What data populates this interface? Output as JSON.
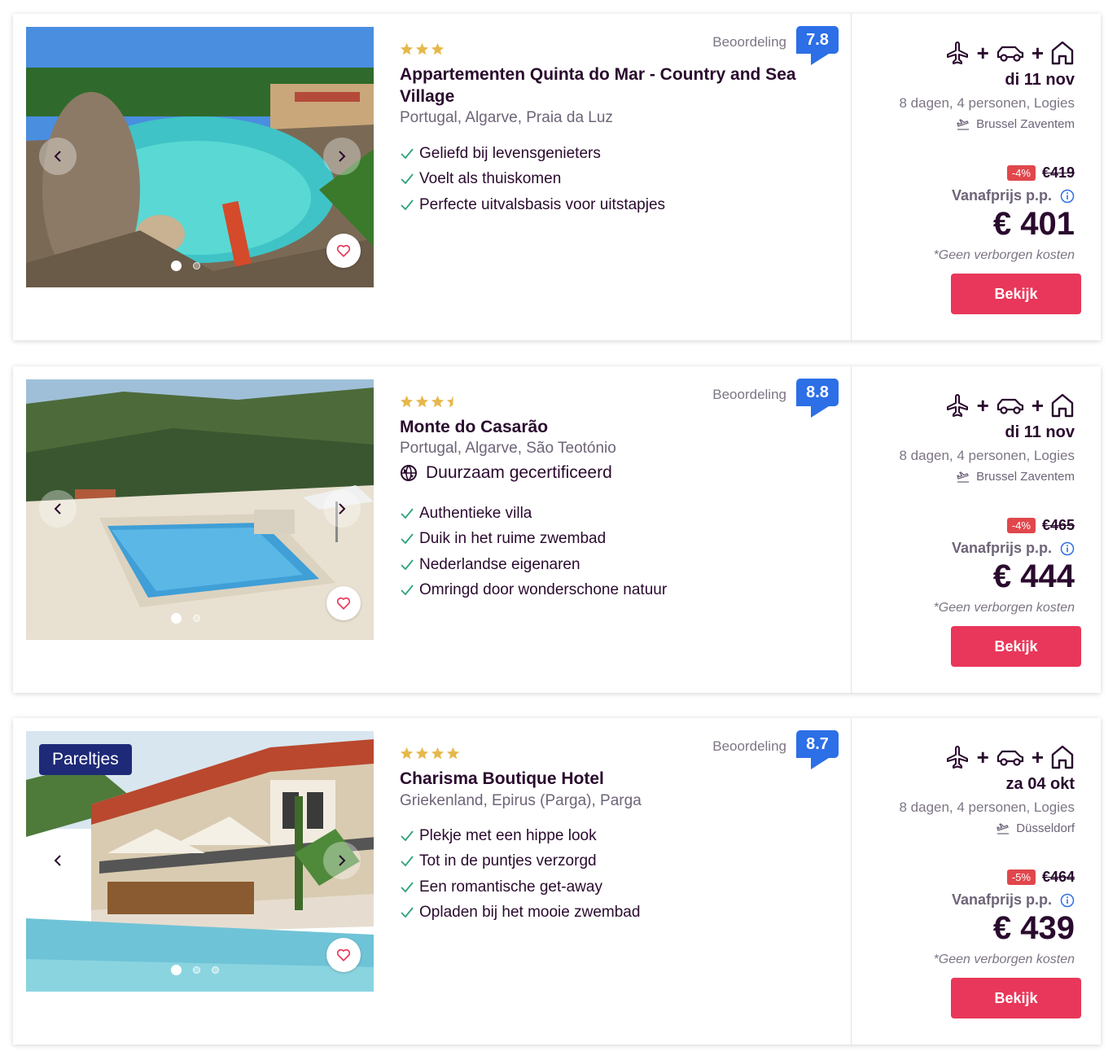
{
  "colors": {
    "accent": "#e8375a",
    "rating": "#2c6fe6",
    "discount": "#e0474c",
    "tag": "#1e2a78",
    "check": "#2fa37a",
    "star": "#e6b84c"
  },
  "labels": {
    "rating": "Beoordeling",
    "from_price": "Vanafprijs p.p.",
    "no_hidden_costs": "*Geen verborgen kosten",
    "cta": "Bekijk"
  },
  "results": [
    {
      "stars": 3,
      "half_star": false,
      "tag": "",
      "title": "Appartementen Quinta do Mar - Country and Sea Village",
      "location": "Portugal,  Algarve,  Praia da Luz",
      "certification": "",
      "rating": "7.8",
      "usps": [
        "Geliefd bij levensgenieters",
        "Voelt als thuiskomen",
        "Perfecte uitvalsbasis voor uitstapjes"
      ],
      "date": "di 11 nov",
      "trip": "8 dagen, 4 personen, Logies",
      "airport": "Brussel Zaventem",
      "discount": "-4%",
      "old_price": "€419",
      "price": "€ 401",
      "image_dots": 2,
      "active_dot": 0
    },
    {
      "stars": 3,
      "half_star": true,
      "tag": "",
      "title": "Monte do Casarão",
      "location": "Portugal,  Algarve,  São Teotónio",
      "certification": "Duurzaam gecertificeerd",
      "rating": "8.8",
      "usps": [
        "Authentieke villa",
        "Duik in het ruime zwembad",
        "Nederlandse eigenaren",
        "Omringd door wonderschone natuur"
      ],
      "date": "di 11 nov",
      "trip": "8 dagen, 4 personen, Logies",
      "airport": "Brussel Zaventem",
      "discount": "-4%",
      "old_price": "€465",
      "price": "€ 444",
      "image_dots": 2,
      "active_dot": 0
    },
    {
      "stars": 4,
      "half_star": false,
      "tag": "Pareltjes",
      "title": "Charisma Boutique Hotel",
      "location": "Griekenland,  Epirus (Parga),  Parga",
      "certification": "",
      "rating": "8.7",
      "usps": [
        "Plekje met een hippe look",
        "Tot in de puntjes verzorgd",
        "Een romantische get-away",
        "Opladen bij het mooie zwembad"
      ],
      "date": "za 04 okt",
      "trip": "8 dagen, 4 personen, Logies",
      "airport": "Düsseldorf",
      "discount": "-5%",
      "old_price": "€464",
      "price": "€ 439",
      "image_dots": 3,
      "active_dot": 0
    }
  ]
}
